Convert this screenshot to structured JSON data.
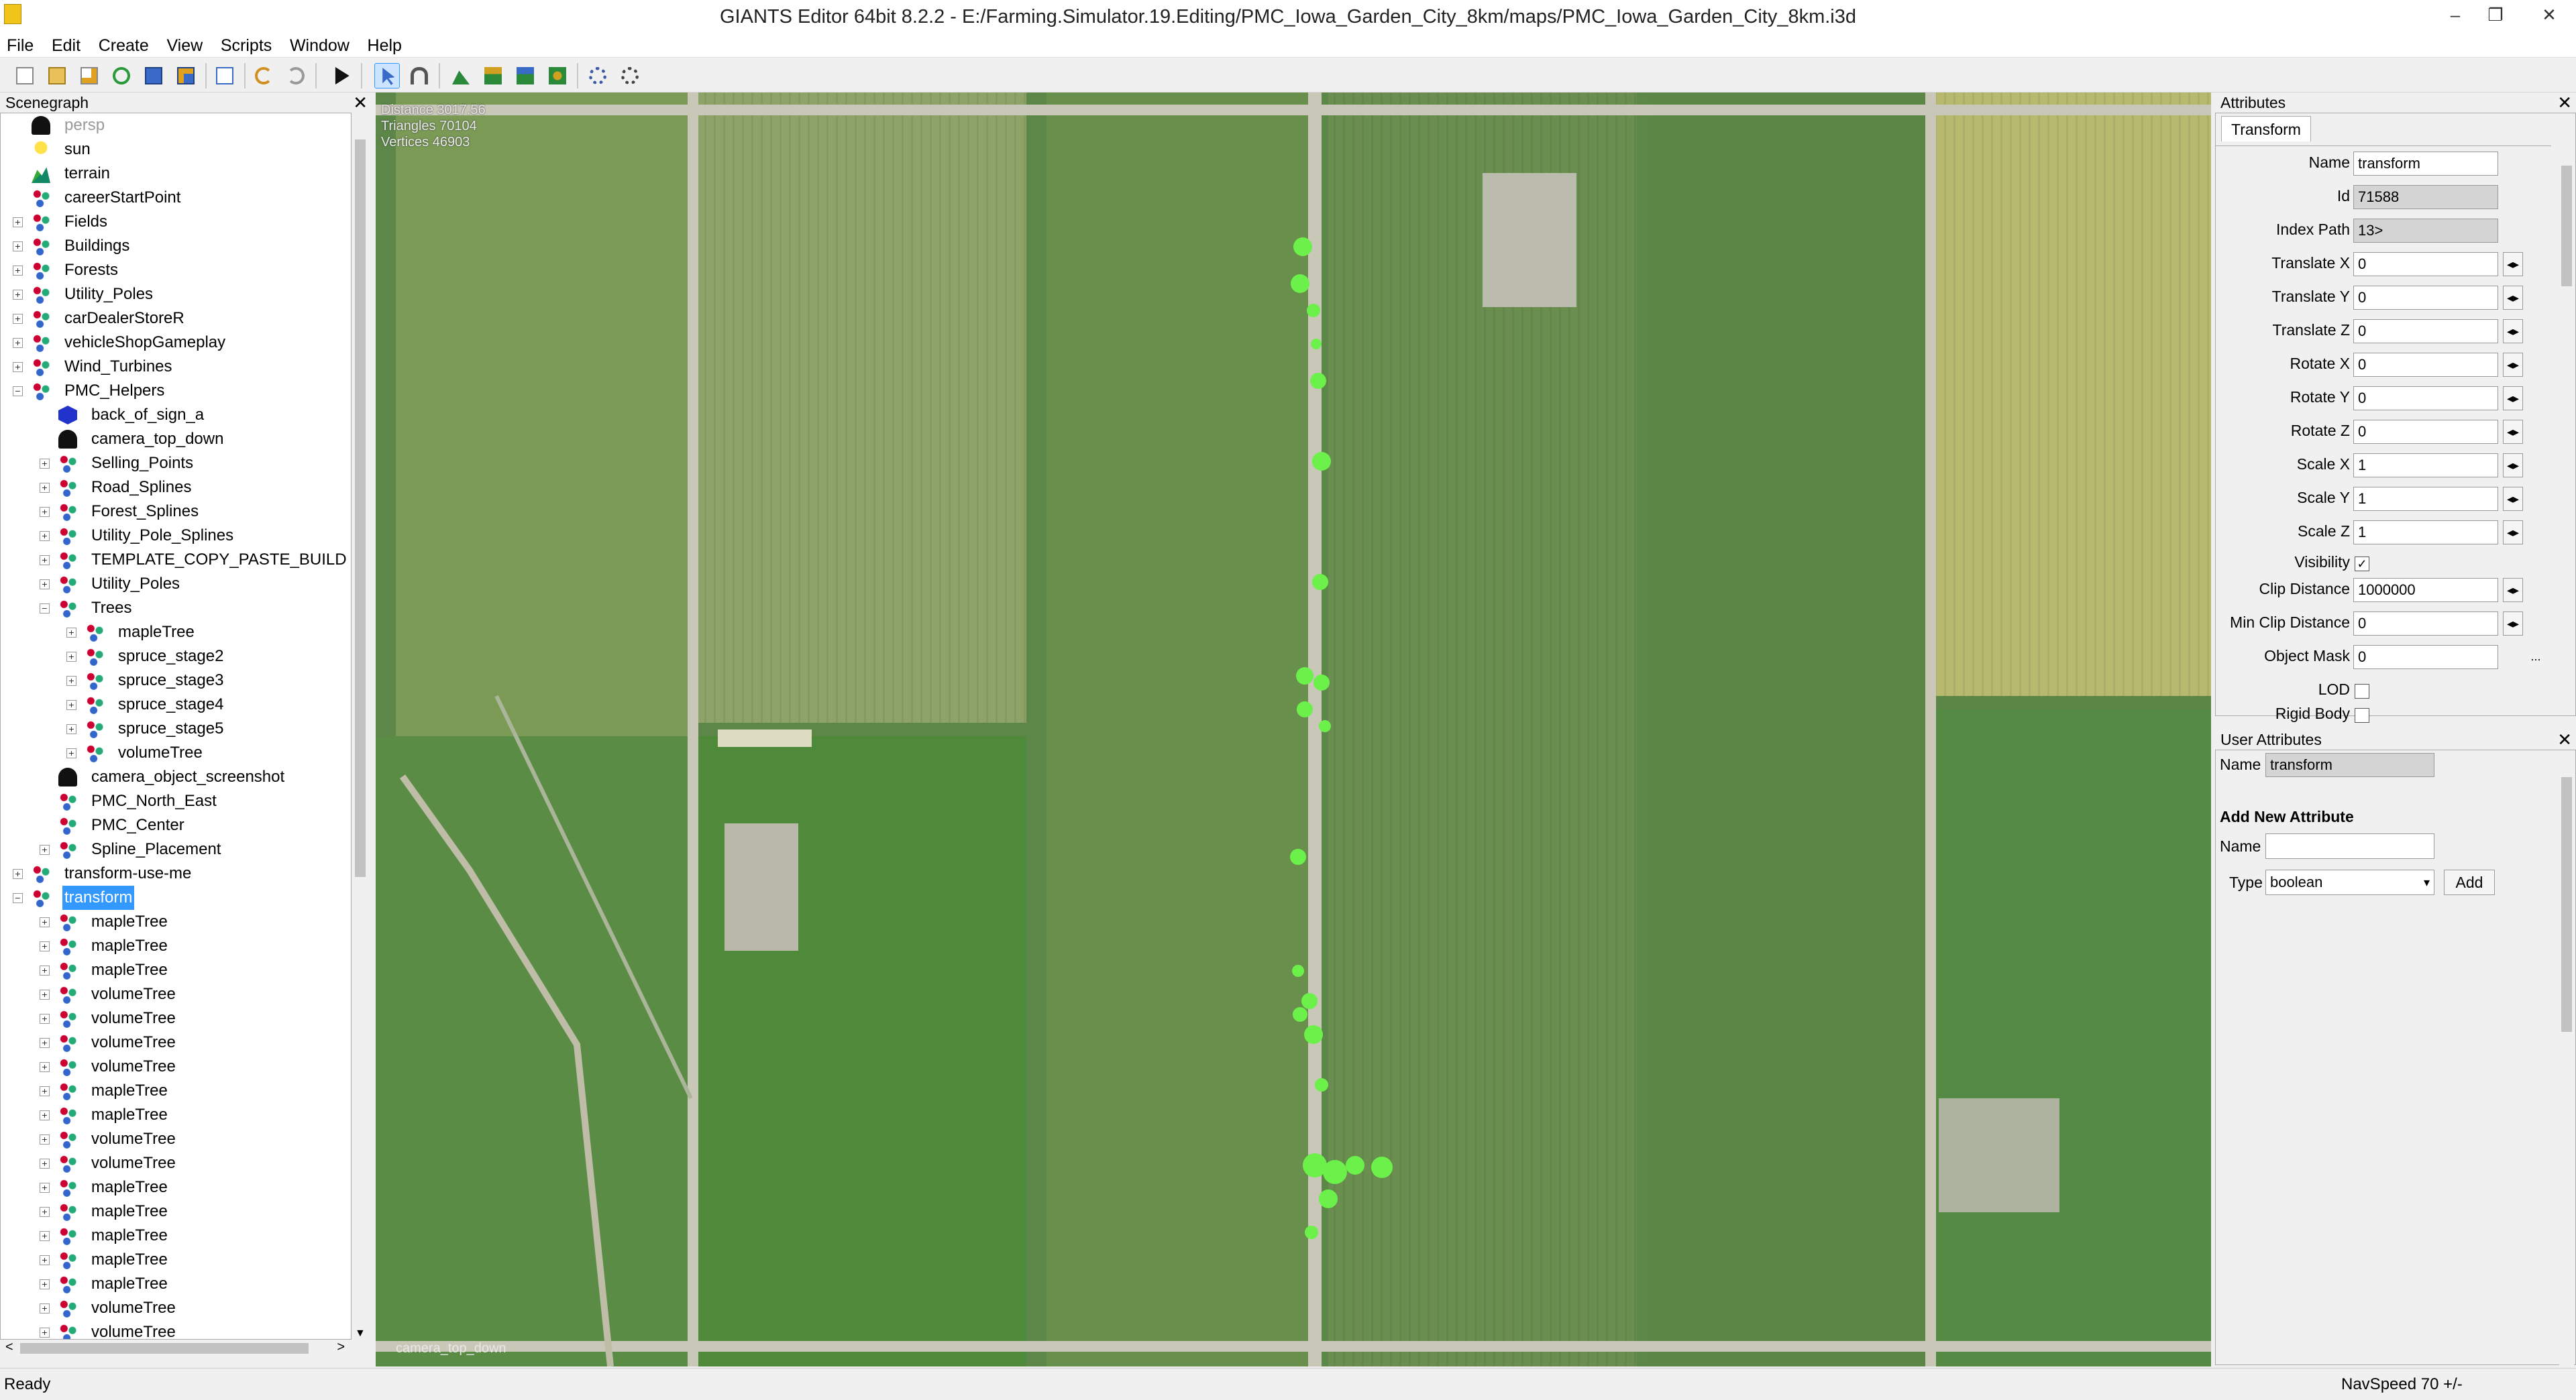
{
  "window": {
    "title": "GIANTS Editor 64bit 8.2.2 - E:/Farming.Simulator.19.Editing/PMC_Iowa_Garden_City_8km/maps/PMC_Iowa_Garden_City_8km.i3d",
    "minimize": "–",
    "restore": "❐",
    "close": "✕"
  },
  "menu": [
    "File",
    "Edit",
    "Create",
    "View",
    "Scripts",
    "Window",
    "Help"
  ],
  "toolbar_icons": [
    "new-file-icon",
    "open-folder-icon",
    "edit-icon",
    "reload-icon",
    "save-icon",
    "save-as-icon",
    "import-icon",
    "undo-icon",
    "redo-icon",
    "play-icon",
    "select-mode-icon",
    "magnet-icon",
    "terrain-paint-icon",
    "terrain-sculpt-icon",
    "foliage-paint-icon",
    "object-place-icon",
    "settings-icon",
    "settings-alt-icon"
  ],
  "scenegraph": {
    "title": "Scenegraph",
    "close": "✕",
    "nodes": [
      {
        "label": "persp",
        "icon": "camera",
        "depth": 1,
        "exp": ""
      },
      {
        "label": "sun",
        "icon": "light",
        "depth": 1,
        "exp": ""
      },
      {
        "label": "terrain",
        "icon": "terrain",
        "depth": 1,
        "exp": ""
      },
      {
        "label": "careerStartPoint",
        "icon": "tg",
        "depth": 1,
        "exp": ""
      },
      {
        "label": "Fields",
        "icon": "tg",
        "depth": 1,
        "exp": "+"
      },
      {
        "label": "Buildings",
        "icon": "tg",
        "depth": 1,
        "exp": "+"
      },
      {
        "label": "Forests",
        "icon": "tg",
        "depth": 1,
        "exp": "+"
      },
      {
        "label": "Utility_Poles",
        "icon": "tg",
        "depth": 1,
        "exp": "+"
      },
      {
        "label": "carDealerStoreR",
        "icon": "tg",
        "depth": 1,
        "exp": "+"
      },
      {
        "label": "vehicleShopGameplay",
        "icon": "tg",
        "depth": 1,
        "exp": "+"
      },
      {
        "label": "Wind_Turbines",
        "icon": "tg",
        "depth": 1,
        "exp": "+"
      },
      {
        "label": "PMC_Helpers",
        "icon": "tg",
        "depth": 1,
        "exp": "−"
      },
      {
        "label": "back_of_sign_a",
        "icon": "cube",
        "depth": 2,
        "exp": ""
      },
      {
        "label": "camera_top_down",
        "icon": "camera",
        "depth": 2,
        "exp": ""
      },
      {
        "label": "Selling_Points",
        "icon": "tg",
        "depth": 2,
        "exp": "+"
      },
      {
        "label": "Road_Splines",
        "icon": "tg",
        "depth": 2,
        "exp": "+"
      },
      {
        "label": "Forest_Splines",
        "icon": "tg",
        "depth": 2,
        "exp": "+"
      },
      {
        "label": "Utility_Pole_Splines",
        "icon": "tg",
        "depth": 2,
        "exp": "+"
      },
      {
        "label": "TEMPLATE_COPY_PASTE_BUILD",
        "icon": "tg",
        "depth": 2,
        "exp": "+"
      },
      {
        "label": "Utility_Poles",
        "icon": "tg",
        "depth": 2,
        "exp": "+"
      },
      {
        "label": "Trees",
        "icon": "tg",
        "depth": 2,
        "exp": "−"
      },
      {
        "label": "mapleTree",
        "icon": "tg",
        "depth": 3,
        "exp": "+"
      },
      {
        "label": "spruce_stage2",
        "icon": "tg",
        "depth": 3,
        "exp": "+"
      },
      {
        "label": "spruce_stage3",
        "icon": "tg",
        "depth": 3,
        "exp": "+"
      },
      {
        "label": "spruce_stage4",
        "icon": "tg",
        "depth": 3,
        "exp": "+"
      },
      {
        "label": "spruce_stage5",
        "icon": "tg",
        "depth": 3,
        "exp": "+"
      },
      {
        "label": "volumeTree",
        "icon": "tg",
        "depth": 3,
        "exp": "+"
      },
      {
        "label": "camera_object_screenshot",
        "icon": "camera",
        "depth": 2,
        "exp": ""
      },
      {
        "label": "PMC_North_East",
        "icon": "tg",
        "depth": 2,
        "exp": ""
      },
      {
        "label": "PMC_Center",
        "icon": "tg",
        "depth": 2,
        "exp": ""
      },
      {
        "label": "Spline_Placement",
        "icon": "tg",
        "depth": 2,
        "exp": "+"
      },
      {
        "label": "transform-use-me",
        "icon": "tg",
        "depth": 1,
        "exp": "+"
      },
      {
        "label": "transform",
        "icon": "tg",
        "depth": 1,
        "exp": "−",
        "selected": true
      },
      {
        "label": "mapleTree",
        "icon": "tg",
        "depth": 2,
        "exp": "+"
      },
      {
        "label": "mapleTree",
        "icon": "tg",
        "depth": 2,
        "exp": "+"
      },
      {
        "label": "mapleTree",
        "icon": "tg",
        "depth": 2,
        "exp": "+"
      },
      {
        "label": "volumeTree",
        "icon": "tg",
        "depth": 2,
        "exp": "+"
      },
      {
        "label": "volumeTree",
        "icon": "tg",
        "depth": 2,
        "exp": "+"
      },
      {
        "label": "volumeTree",
        "icon": "tg",
        "depth": 2,
        "exp": "+"
      },
      {
        "label": "volumeTree",
        "icon": "tg",
        "depth": 2,
        "exp": "+"
      },
      {
        "label": "mapleTree",
        "icon": "tg",
        "depth": 2,
        "exp": "+"
      },
      {
        "label": "mapleTree",
        "icon": "tg",
        "depth": 2,
        "exp": "+"
      },
      {
        "label": "volumeTree",
        "icon": "tg",
        "depth": 2,
        "exp": "+"
      },
      {
        "label": "volumeTree",
        "icon": "tg",
        "depth": 2,
        "exp": "+"
      },
      {
        "label": "mapleTree",
        "icon": "tg",
        "depth": 2,
        "exp": "+"
      },
      {
        "label": "mapleTree",
        "icon": "tg",
        "depth": 2,
        "exp": "+"
      },
      {
        "label": "mapleTree",
        "icon": "tg",
        "depth": 2,
        "exp": "+"
      },
      {
        "label": "mapleTree",
        "icon": "tg",
        "depth": 2,
        "exp": "+"
      },
      {
        "label": "mapleTree",
        "icon": "tg",
        "depth": 2,
        "exp": "+"
      },
      {
        "label": "volumeTree",
        "icon": "tg",
        "depth": 2,
        "exp": "+"
      },
      {
        "label": "volumeTree",
        "icon": "tg",
        "depth": 2,
        "exp": "+"
      }
    ],
    "scroll_left": "<",
    "scroll_right": ">",
    "scroll_up": "▲",
    "scroll_down": "▼"
  },
  "viewport": {
    "distance": "Distance 3017.56",
    "triangles": "Triangles 70104",
    "vertices": "Vertices 46903",
    "camera_label": "camera_top_down"
  },
  "attributes": {
    "title": "Attributes",
    "close": "✕",
    "tab": "Transform",
    "fields": [
      {
        "label": "Name",
        "value": "transform",
        "kind": "text"
      },
      {
        "label": "Id",
        "value": "71588",
        "kind": "readonly"
      },
      {
        "label": "Index Path",
        "value": "13>",
        "kind": "readonly"
      },
      {
        "label": "Translate X",
        "value": "0",
        "kind": "spin"
      },
      {
        "label": "Translate Y",
        "value": "0",
        "kind": "spin"
      },
      {
        "label": "Translate Z",
        "value": "0",
        "kind": "spin"
      },
      {
        "label": "Rotate X",
        "value": "0",
        "kind": "spin"
      },
      {
        "label": "Rotate Y",
        "value": "0",
        "kind": "spin"
      },
      {
        "label": "Rotate Z",
        "value": "0",
        "kind": "spin"
      },
      {
        "label": "Scale X",
        "value": "1",
        "kind": "spin"
      },
      {
        "label": "Scale Y",
        "value": "1",
        "kind": "spin"
      },
      {
        "label": "Scale Z",
        "value": "1",
        "kind": "spin"
      },
      {
        "label": "Visibility",
        "value": "✓",
        "kind": "check"
      },
      {
        "label": "Clip Distance",
        "value": "1000000",
        "kind": "spin"
      },
      {
        "label": "Min Clip Distance",
        "value": "0",
        "kind": "spin"
      },
      {
        "label": "Object Mask",
        "value": "0",
        "kind": "dots"
      },
      {
        "label": "LOD",
        "value": "",
        "kind": "check"
      },
      {
        "label": "Rigid Body",
        "value": "",
        "kind": "check"
      }
    ],
    "spin_glyph": "◂▸",
    "dots": "..."
  },
  "user_attributes": {
    "title": "User Attributes",
    "close": "✕",
    "name_label": "Name",
    "name_value": "transform",
    "add_heading": "Add New Attribute",
    "new_name_label": "Name",
    "new_name_value": "",
    "type_label": "Type",
    "type_value": "boolean",
    "add_button": "Add"
  },
  "status": {
    "left": "Ready",
    "right": "NavSpeed 70 +/-"
  },
  "colors": {
    "selection": "#3399ff",
    "field_dark": "#4f7a3c",
    "field_light": "#9fb565",
    "road": "#c9c7b8",
    "tree_highlight": "#6cf04a"
  }
}
